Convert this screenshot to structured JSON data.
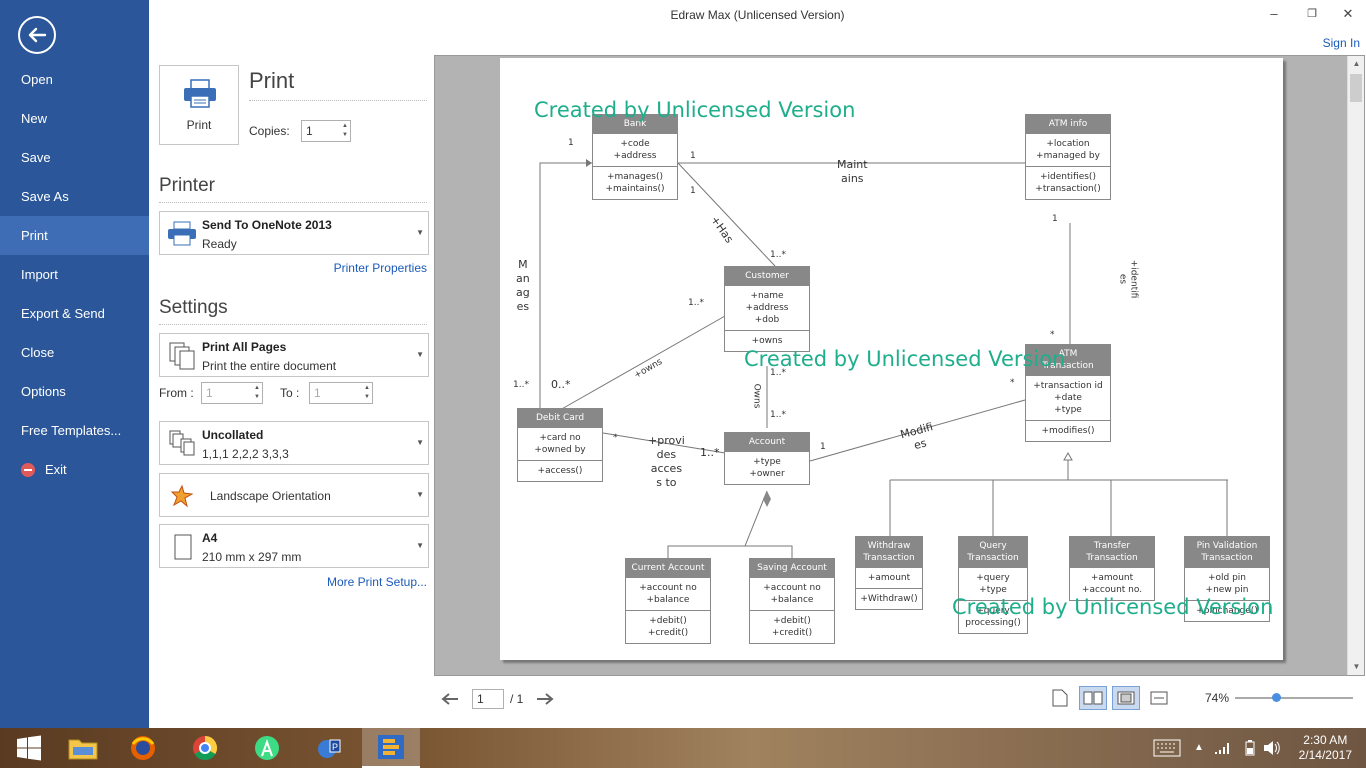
{
  "window": {
    "title": "Edraw Max (Unlicensed Version)",
    "sign_in": "Sign In",
    "minimize": "–",
    "restore": "❐",
    "close": "✕"
  },
  "sidebar": {
    "items": [
      {
        "label": "Open"
      },
      {
        "label": "New"
      },
      {
        "label": "Save"
      },
      {
        "label": "Save As"
      },
      {
        "label": "Print",
        "active": true
      },
      {
        "label": "Import"
      },
      {
        "label": "Export & Send"
      },
      {
        "label": "Close"
      },
      {
        "label": "Options"
      },
      {
        "label": "Free Templates..."
      },
      {
        "label": "Exit"
      }
    ]
  },
  "print": {
    "heading": "Print",
    "button_label": "Print",
    "copies_label": "Copies:",
    "copies_value": "1"
  },
  "printer": {
    "heading": "Printer",
    "name": "Send To OneNote 2013",
    "status": "Ready",
    "properties_link": "Printer Properties"
  },
  "settings": {
    "heading": "Settings",
    "pages_title": "Print All Pages",
    "pages_sub": "Print the entire document",
    "from_label": "From :",
    "from_value": "1",
    "to_label": "To :",
    "to_value": "1",
    "collate_title": "Uncollated",
    "collate_sub": "1,1,1   2,2,2   3,3,3",
    "orientation": "Landscape Orientation",
    "paper_title": "A4",
    "paper_sub": "210 mm x 297 mm",
    "more_link": "More Print Setup..."
  },
  "diagram": {
    "watermark": "Created by Unlicensed Version",
    "classes": {
      "bank": {
        "name": "Bank",
        "attrs": [
          "+code",
          "+address"
        ],
        "ops": [
          "+manages()",
          "+maintains()"
        ]
      },
      "atm_info": {
        "name": "ATM info",
        "attrs": [
          "+location",
          "+managed by"
        ],
        "ops": [
          "+identifies()",
          "+transaction()"
        ]
      },
      "customer": {
        "name": "Customer",
        "attrs": [
          "+name",
          "+address",
          "+dob"
        ],
        "ops": [
          "+owns"
        ]
      },
      "atm_transaction": {
        "name": "ATM\nTransaction",
        "attrs": [
          "+transaction id",
          "+date",
          "+type"
        ],
        "ops": [
          "+modifies()"
        ]
      },
      "debit_card": {
        "name": "Debit Card",
        "attrs": [
          "+card no",
          "+owned by"
        ],
        "ops": [
          "+access()"
        ]
      },
      "account": {
        "name": "Account",
        "attrs": [
          "+type",
          "+owner"
        ],
        "ops": []
      },
      "current_account": {
        "name": "Current Account",
        "attrs": [
          "+account no",
          "+balance"
        ],
        "ops": [
          "+debit()",
          "+credit()"
        ]
      },
      "saving_account": {
        "name": "Saving Account",
        "attrs": [
          "+account no",
          "+balance"
        ],
        "ops": [
          "+debit()",
          "+credit()"
        ]
      },
      "withdraw": {
        "name": "Withdraw\nTransaction",
        "attrs": [
          "+amount"
        ],
        "ops": [
          "+Withdraw()"
        ]
      },
      "query": {
        "name": "Query\nTransaction",
        "attrs": [
          "+query",
          "+type"
        ],
        "ops": [
          "+query\nprocessing()"
        ]
      },
      "transfer": {
        "name": "Transfer\nTransaction",
        "attrs": [
          "+amount",
          "+account no."
        ],
        "ops": []
      },
      "pin": {
        "name": "Pin Validation\nTransaction",
        "attrs": [
          "+old pin",
          "+new pin"
        ],
        "ops": [
          "+pinchange()"
        ]
      }
    },
    "labels": {
      "maintains": "Maint\nains",
      "has": "+Has",
      "manages": "M\nan\nag\nes",
      "identifies": "+identifi\nes",
      "owns_line": "+owns",
      "owns": "Owns",
      "provides_access": "+provi\ndes\nacces\ns to",
      "modifies": "Modifi\nes",
      "m1a": "1",
      "m1b": "1",
      "m1c": "1",
      "m1d": "1",
      "m_many_a": "1..*",
      "m_many_b": "1..*",
      "m_many_c": "1..*",
      "m_many_d": "1..*",
      "m_many_e": "1..*",
      "m_many_f": "1..*",
      "m_star_a": "*",
      "m_star_b": "*",
      "m_star_c": "*",
      "m_zero": "0..*"
    }
  },
  "pager": {
    "page_value": "1",
    "page_total": "/ 1"
  },
  "zoom": {
    "label": "74%",
    "level": 0.35
  },
  "taskbar": {
    "time": "2:30 AM",
    "date": "2/14/2017"
  },
  "colors": {
    "sidebar": "#2b579a",
    "sidebar_active": "#3e6db5",
    "watermark": "#1fae8c",
    "class_header": "#888888",
    "link": "#1b5bb8"
  }
}
